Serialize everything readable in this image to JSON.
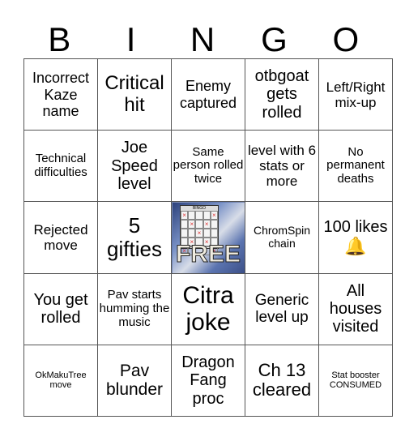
{
  "header": {
    "letters": [
      "B",
      "I",
      "N",
      "G",
      "O"
    ]
  },
  "free_space": {
    "label": "FREE",
    "thumbnail_title": "BINGO",
    "marks": [
      "×",
      "",
      "",
      "",
      "×",
      "",
      "×",
      "",
      "×",
      "",
      "",
      "",
      "×",
      "",
      "",
      "",
      "×",
      "",
      "×",
      "",
      "×",
      "",
      "",
      "",
      "×"
    ]
  },
  "cells": [
    [
      {
        "text": "Incorrect Kaze name",
        "size": 18
      },
      {
        "text": "Critical hit",
        "size": 24
      },
      {
        "text": "Enemy captured",
        "size": 18
      },
      {
        "text": "otbgoat gets rolled",
        "size": 20
      },
      {
        "text": "Left/Right mix-up",
        "size": 17
      }
    ],
    [
      {
        "text": "Technical difficulties",
        "size": 15
      },
      {
        "text": "Joe Speed level",
        "size": 20
      },
      {
        "text": "Same person rolled twice",
        "size": 15
      },
      {
        "text": "level with 6 stats or more",
        "size": 17
      },
      {
        "text": "No permanent deaths",
        "size": 15
      }
    ],
    [
      {
        "text": "Rejected move",
        "size": 17
      },
      {
        "text": "5 gifties",
        "size": 26
      },
      {
        "free": true
      },
      {
        "text": "ChromSpin chain",
        "size": 14
      },
      {
        "text": "100 likes",
        "size": 20,
        "icon": "bell-icon",
        "icon_glyph": "🔔"
      }
    ],
    [
      {
        "text": "You get rolled",
        "size": 20
      },
      {
        "text": "Pav starts humming the music",
        "size": 15
      },
      {
        "text": "Citra joke",
        "size": 30
      },
      {
        "text": "Generic level up",
        "size": 19
      },
      {
        "text": "All houses visited",
        "size": 20
      }
    ],
    [
      {
        "text": "OkMakuTree move",
        "size": 11
      },
      {
        "text": "Pav blunder",
        "size": 21
      },
      {
        "text": "Dragon Fang proc",
        "size": 20
      },
      {
        "text": "Ch 13 cleared",
        "size": 22
      },
      {
        "text": "Stat booster CONSUMED",
        "size": 11
      }
    ]
  ]
}
